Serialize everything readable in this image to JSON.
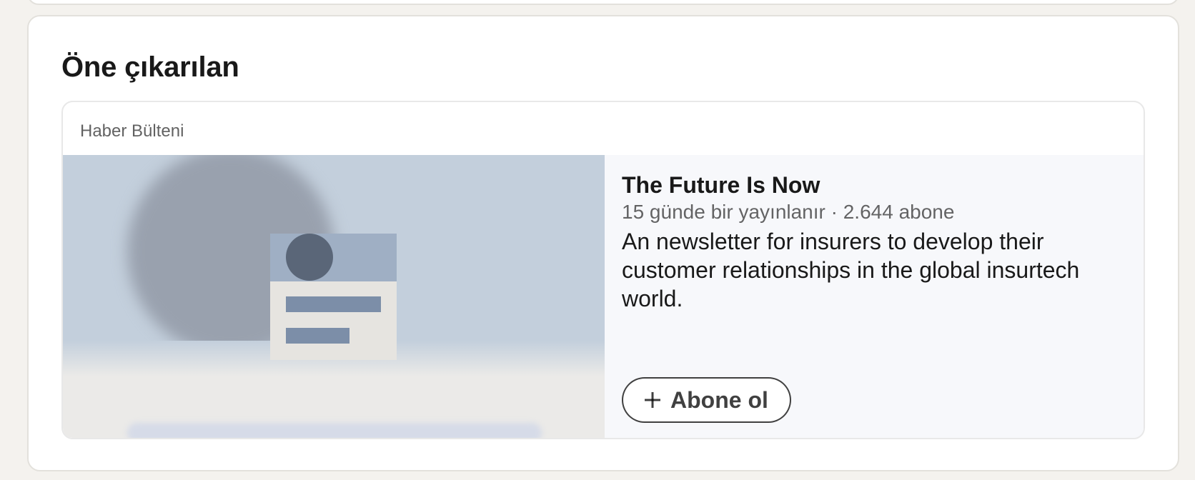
{
  "section": {
    "title": "Öne çıkarılan"
  },
  "featured": {
    "item_type": "Haber Bülteni",
    "newsletter": {
      "title": "The Future Is Now",
      "meta": "15 günde bir yayınlanır · 2.644 abone",
      "description": "An newsletter for insurers to develop their customer relationships in the global insurtech world."
    },
    "subscribe": {
      "icon": "plus-icon",
      "label": "Abone ol"
    }
  }
}
